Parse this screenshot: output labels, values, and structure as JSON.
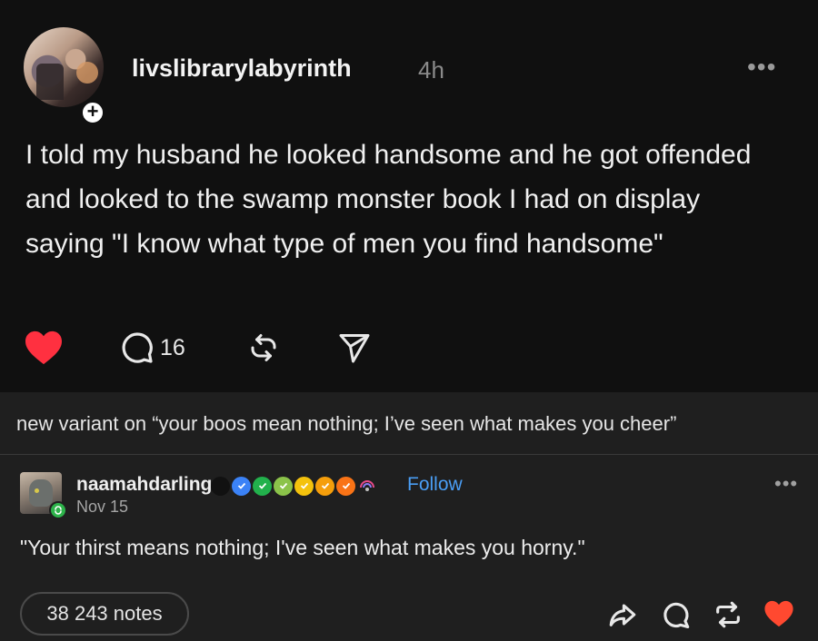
{
  "post": {
    "author": "livslibrarylabyrinth",
    "time": "4h",
    "text": "I told my husband he looked handsome and he got offended and looked to the swamp monster book I had on display saying \"I know what type of men you find handsome\"",
    "reply_count": "16",
    "plus_symbol": "+",
    "more_symbol": "•••",
    "liked": true,
    "like_color": "#ff3040"
  },
  "caption": "new variant on “your boos mean nothing; I’ve seen what makes you cheer”",
  "reply": {
    "author": "naamahdarling",
    "follow_label": "Follow",
    "date": "Nov 15",
    "text": "\"Your thirst means nothing; I've seen what makes you horny.\"",
    "more_symbol": "•••",
    "badges": [
      "#111111",
      "#3b82f6",
      "#22b14c",
      "#8bc34a",
      "#f4c20d",
      "#f59e0b",
      "#f97316"
    ]
  },
  "footer": {
    "notes": "38 243 notes",
    "heart_color": "#ff4930"
  }
}
